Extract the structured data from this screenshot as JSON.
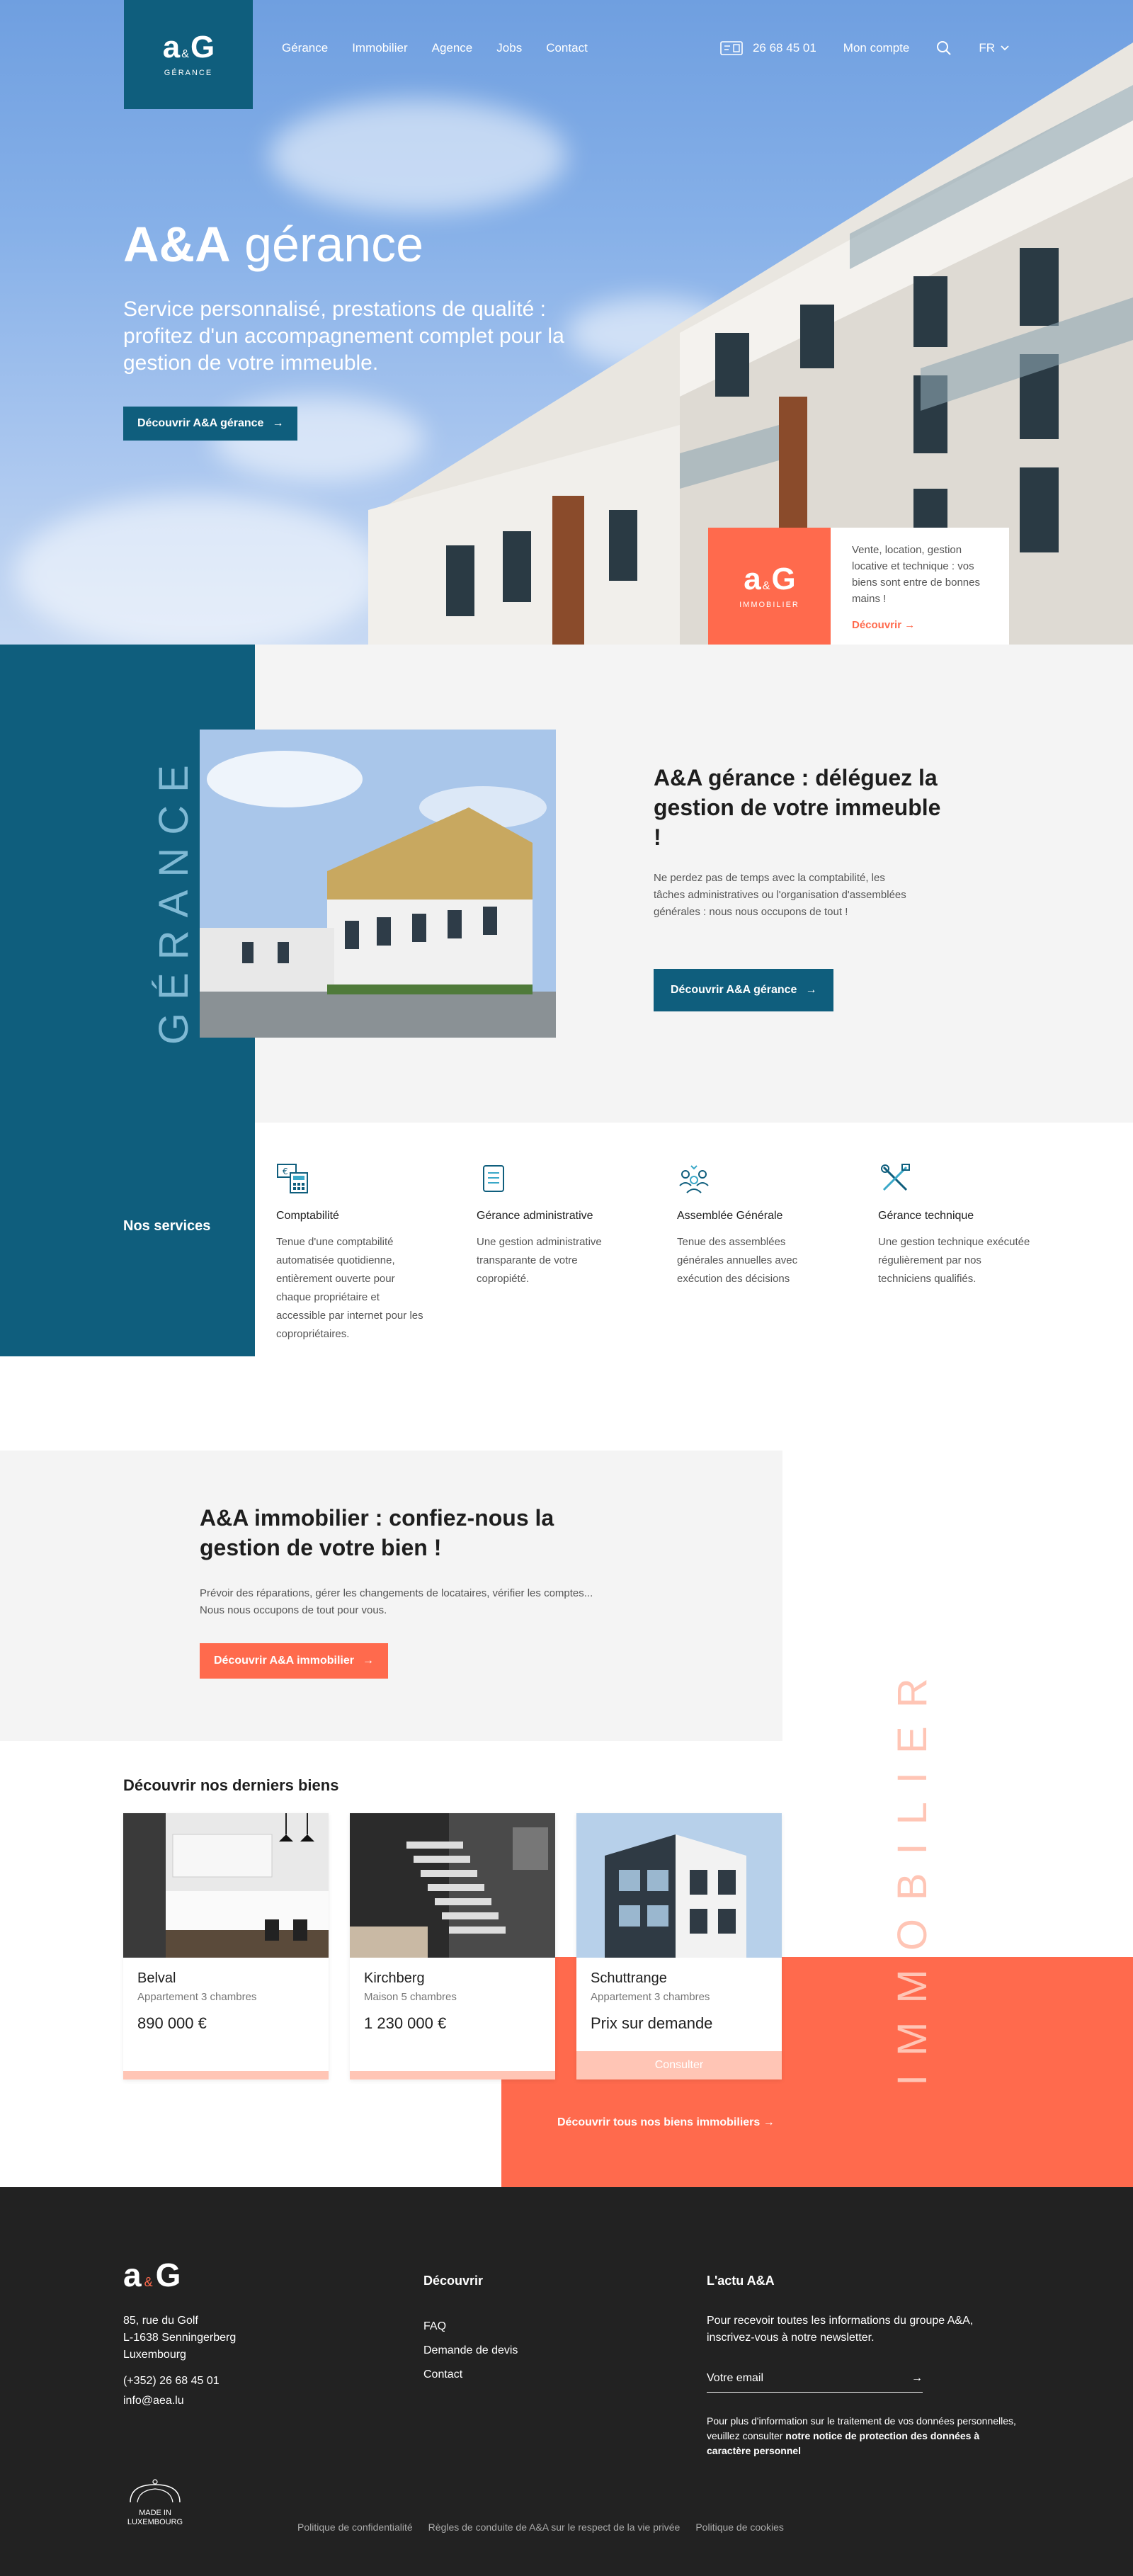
{
  "header": {
    "logo": {
      "mark_a": "a",
      "mark_amp": "&",
      "mark_b": "G",
      "sub": "GÉRANCE"
    },
    "nav": [
      "Gérance",
      "Immobilier",
      "Agence",
      "Jobs",
      "Contact"
    ],
    "phone": "26 68 45 01",
    "account": "Mon compte",
    "lang": "FR"
  },
  "hero": {
    "title_bold": "A&A",
    "title_light": " gérance",
    "subtitle": "Service personnalisé, prestations de qualité : profitez d'un accompagnement complet pour la gestion de votre immeuble.",
    "button": "Découvrir A&A gérance",
    "immo_card": {
      "logo_sub": "IMMOBILIER",
      "text": "Vente, location, gestion locative et technique : vos biens sont entre de bonnes mains !",
      "link": "Découvrir"
    }
  },
  "gerance": {
    "vertical": "GÉRANCE",
    "title": "A&A gérance : déléguez la gestion de votre immeuble !",
    "text": "Ne perdez pas de temps avec la comptabilité, les tâches administratives ou l'organisation d'assemblées générales : nous nous occupons de tout !",
    "button": "Découvrir A&A gérance",
    "services_label": "Nos services",
    "services": [
      {
        "title": "Comptabilité",
        "text": "Tenue d'une comptabilité automatisée quotidienne, entièrement ouverte pour chaque propriétaire et accessible par internet pour les copropriétaires."
      },
      {
        "title": "Gérance administrative",
        "text": "Une gestion administrative transparante de votre copropiété."
      },
      {
        "title": "Assemblée Générale",
        "text": "Tenue des assemblées générales annuelles avec exécution des décisions"
      },
      {
        "title": "Gérance technique",
        "text": "Une gestion technique exécutée régulièrement par nos techniciens qualifiés."
      }
    ]
  },
  "immobilier": {
    "vertical": "IMMOBILIER",
    "title": "A&A immobilier : confiez-nous la gestion de votre bien !",
    "text": "Prévoir des réparations, gérer les changements de locataires, vérifier les comptes... Nous nous occupons de tout pour vous.",
    "button": "Découvrir A&A immobilier",
    "latest_title": "Découvrir nos derniers biens",
    "properties": [
      {
        "city": "Belval",
        "type": "Appartement 3 chambres",
        "price": "890 000 €"
      },
      {
        "city": "Kirchberg",
        "type": "Maison 5 chambres",
        "price": "1 230 000 €"
      },
      {
        "city": "Schuttrange",
        "type": "Appartement 3 chambres",
        "price": "Prix sur demande",
        "consult": "Consulter"
      }
    ],
    "see_all": "Découvrir tous nos biens immobiliers"
  },
  "footer": {
    "address": [
      "85, rue du Golf",
      "L-1638 Senningerberg",
      "Luxembourg"
    ],
    "phone": "(+352) 26 68 45 01",
    "email": "info@aea.lu",
    "col_discover": "Découvrir",
    "links": [
      "FAQ",
      "Demande de devis",
      "Contact"
    ],
    "col_news": "L'actu A&A",
    "news_text": "Pour recevoir toutes les informations du groupe A&A, inscrivez-vous à notre newsletter.",
    "email_placeholder": "Votre email",
    "legal_text": "Pour plus d'information sur le traitement de vos données personnelles, veuillez consulter ",
    "legal_bold": "notre notice de protection des données à caractère personnel",
    "made_in": "MADE IN LUXEMBOURG",
    "bottom_links": [
      "Politique de confidentialité",
      "Règles de conduite de A&A sur le respect de la vie privée",
      "Politique de cookies"
    ]
  },
  "colors": {
    "blue": "#0f5e7d",
    "orange": "#ff6a4d",
    "dark": "#222222",
    "grey": "#f4f4f4"
  }
}
